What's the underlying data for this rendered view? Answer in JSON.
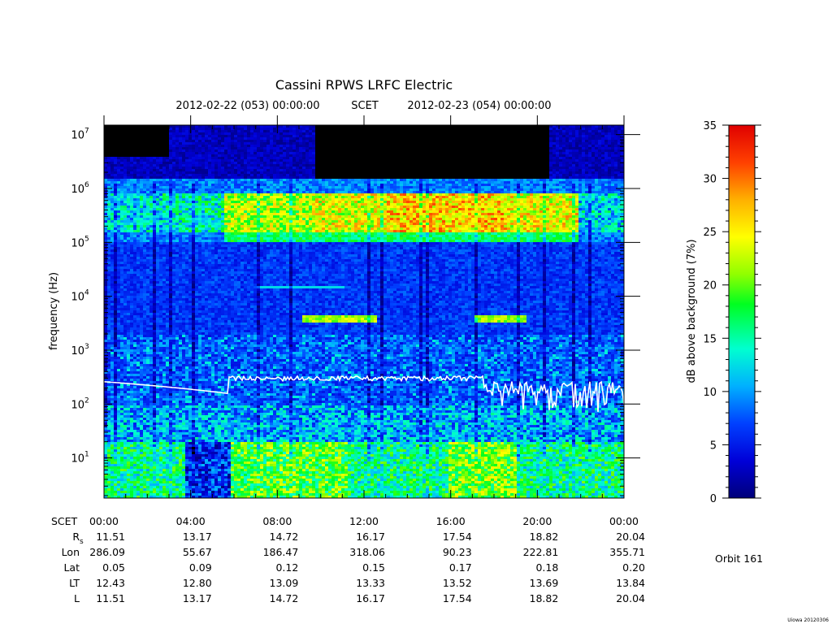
{
  "chart_data": {
    "type": "heatmap",
    "title": "Cassini RPWS LRFC Electric",
    "time_range": {
      "start": "2012-02-22 (053) 00:00:00",
      "label": "SCET",
      "end": "2012-02-23 (054) 00:00:00"
    },
    "ylabel": "frequency (Hz)",
    "y_scale": "log",
    "ylim": [
      1.8,
      15000000
    ],
    "y_ticks": [
      {
        "base": "10",
        "exp": "1"
      },
      {
        "base": "10",
        "exp": "2"
      },
      {
        "base": "10",
        "exp": "3"
      },
      {
        "base": "10",
        "exp": "4"
      },
      {
        "base": "10",
        "exp": "5"
      },
      {
        "base": "10",
        "exp": "6"
      },
      {
        "base": "10",
        "exp": "7"
      }
    ],
    "x_ticks": [
      "00:00",
      "04:00",
      "08:00",
      "12:00",
      "16:00",
      "20:00",
      "00:00"
    ],
    "colorbar": {
      "label": "dB above background (7%)",
      "range": [
        0,
        35
      ],
      "ticks": [
        "0",
        "5",
        "10",
        "15",
        "20",
        "25",
        "30",
        "35"
      ]
    },
    "ephemeris": {
      "rows": [
        {
          "label": "SCET",
          "values": [
            "00:00",
            "04:00",
            "08:00",
            "12:00",
            "16:00",
            "20:00",
            "00:00"
          ]
        },
        {
          "label": "R",
          "sub": "s",
          "values": [
            "11.51",
            "13.17",
            "14.72",
            "16.17",
            "17.54",
            "18.82",
            "20.04"
          ]
        },
        {
          "label": "Lon",
          "values": [
            "286.09",
            "55.67",
            "186.47",
            "318.06",
            "90.23",
            "222.81",
            "355.71"
          ]
        },
        {
          "label": "Lat",
          "values": [
            "0.05",
            "0.09",
            "0.12",
            "0.15",
            "0.17",
            "0.18",
            "0.20"
          ]
        },
        {
          "label": "LT",
          "values": [
            "12.43",
            "12.80",
            "13.09",
            "13.33",
            "13.52",
            "13.69",
            "13.84"
          ]
        },
        {
          "label": "L",
          "values": [
            "11.51",
            "13.17",
            "14.72",
            "16.17",
            "17.54",
            "18.82",
            "20.04"
          ]
        }
      ]
    },
    "orbit": "Orbit 161",
    "credit": "Uiowa 20120306"
  }
}
